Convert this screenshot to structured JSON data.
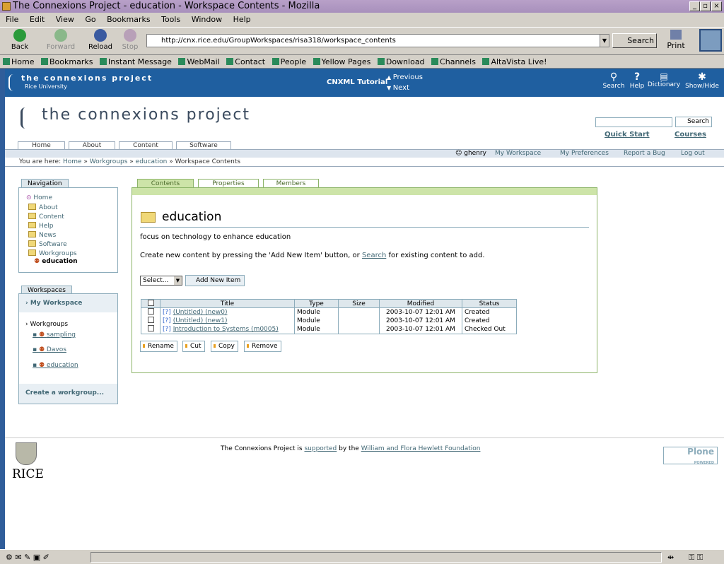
{
  "window": {
    "title": "The Connexions Project - education - Workspace Contents - Mozilla"
  },
  "menu": [
    "File",
    "Edit",
    "View",
    "Go",
    "Bookmarks",
    "Tools",
    "Window",
    "Help"
  ],
  "toolbar": {
    "back": "Back",
    "forward": "Forward",
    "reload": "Reload",
    "stop": "Stop",
    "url": "http://cnx.rice.edu/GroupWorkspaces/risa318/workspace_contents",
    "search": "Search",
    "print": "Print"
  },
  "bookmarks": [
    "Home",
    "Bookmarks",
    "Instant Message",
    "WebMail",
    "Contact",
    "People",
    "Yellow Pages",
    "Download",
    "Channels",
    "AltaVista Live!"
  ],
  "cnxbar": {
    "title": "the connexions project",
    "sub": "Rice University",
    "tutorial": "CNXML Tutorial",
    "previous": "Previous",
    "next": "Next",
    "tools": [
      "Search",
      "Help",
      "Dictionary",
      "Show/Hide"
    ]
  },
  "site": {
    "logo": "the connexions project",
    "search_button": "Search",
    "quick_start": "Quick Start",
    "courses": "Courses",
    "tabs": [
      "Home",
      "About",
      "Content",
      "Software"
    ],
    "user": "ghenry",
    "user_actions": [
      "My Workspace",
      "My Preferences",
      "Report a Bug",
      "Log out"
    ],
    "breadcrumb": {
      "prefix": "You are here:",
      "items": [
        "Home",
        "Workgroups",
        "education",
        "Workspace Contents"
      ]
    }
  },
  "navigation": {
    "title": "Navigation",
    "items": [
      "Home",
      "About",
      "Content",
      "Help",
      "News",
      "Software",
      "Workgroups",
      "education"
    ]
  },
  "workspaces": {
    "title": "Workspaces",
    "my_workspace": "My Workspace",
    "workgroups_label": "Workgroups",
    "groups": [
      "sampling",
      "Davos",
      "education"
    ],
    "create": "Create a workgroup..."
  },
  "content": {
    "tabs": [
      "Contents",
      "Properties",
      "Members"
    ],
    "heading": "education",
    "description": "focus on technology to enhance education",
    "instructions_pre": "Create new content by pressing the 'Add New Item' button, or ",
    "instructions_link": "Search",
    "instructions_post": " for existing content to add.",
    "select_value": "Select...",
    "add_button": "Add New Item",
    "columns": [
      "Title",
      "Type",
      "Size",
      "Modified",
      "Status"
    ],
    "rows": [
      {
        "title": "(Untitled) (new0)",
        "type": "Module",
        "size": "",
        "modified": "2003-10-07 12:01 AM",
        "status": "Created"
      },
      {
        "title": "(Untitled) (new1)",
        "type": "Module",
        "size": "",
        "modified": "2003-10-07 12:01 AM",
        "status": "Created"
      },
      {
        "title": "Introduction to Systems (m0005)",
        "type": "Module",
        "size": "",
        "modified": "2003-10-07 12:01 AM",
        "status": "Checked Out"
      }
    ],
    "actions": [
      "Rename",
      "Cut",
      "Copy",
      "Remove"
    ]
  },
  "footer": {
    "pre": "The Connexions Project is ",
    "link1": "supported",
    "mid": " by the ",
    "link2": "William and Flora Hewlett Foundation",
    "rice": "RICE",
    "plone": "Plone",
    "plone_sub": "POWERED"
  }
}
